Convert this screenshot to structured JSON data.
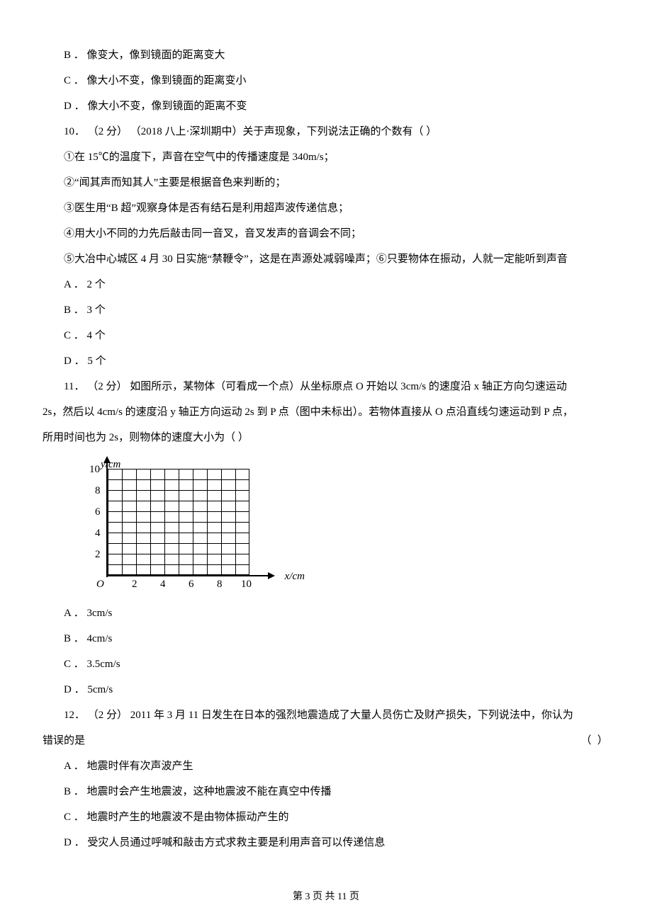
{
  "q9": {
    "opt_b": "B ． 像变大，像到镜面的距离变大",
    "opt_c": "C ． 像大小不变，像到镜面的距离变小",
    "opt_d": "D ． 像大小不变，像到镜面的距离不变"
  },
  "q10": {
    "stem": "10．  （2 分）  （2018 八上·深圳期中）关于声现象，下列说法正确的个数有（      ）",
    "s1": "①在 15℃的温度下，声音在空气中的传播速度是 340m/s；",
    "s2": "②“闻其声而知其人”主要是根据音色来判断的；",
    "s3": "③医生用“B 超”观察身体是否有结石是利用超声波传递信息；",
    "s4": "④用大小不同的力先后敲击同一音叉，音叉发声的音调会不同；",
    "s5": "⑤大冶中心城区 4 月 30 日实施“禁鞭令”，这是在声源处减弱噪声；⑥只要物体在振动，人就一定能听到声音",
    "opt_a": "A ． 2 个",
    "opt_b": "B ． 3 个",
    "opt_c": "C ． 4 个",
    "opt_d": "D ． 5 个"
  },
  "q11": {
    "stem_l1": "11．  （2 分）   如图所示，某物体（可看成一个点）从坐标原点 O 开始以 3cm/s 的速度沿 x 轴正方向匀速运动",
    "stem_l2": "2s，然后以 4cm/s 的速度沿 y 轴正方向运动 2s 到 P 点（图中未标出）。若物体直接从 O 点沿直线匀速运动到 P 点，",
    "stem_l3": "所用时间也为 2s，则物体的速度大小为（      ）",
    "opt_a": "A ． 3cm/s",
    "opt_b": "B ． 4cm/s",
    "opt_c": "C ． 3.5cm/s",
    "opt_d": "D ． 5cm/s"
  },
  "q12": {
    "stem_l1": "12．  （2 分）   2011 年 3 月 11 日发生在日本的强烈地震造成了大量人员伤亡及财产损失，下列说法中，你认为",
    "stem_l2_left": "错误的是",
    "stem_l2_right": "（      ）",
    "opt_a": "A ．  地震时伴有次声波产生",
    "opt_b": "B ．  地震时会产生地震波，这种地震波不能在真空中传播",
    "opt_c": "C ．  地震时产生的地震波不是由物体振动产生的",
    "opt_d": "D ．  受灾人员通过呼喊和敲击方式求救主要是利用声音可以传递信息"
  },
  "chart_data": {
    "type": "scatter",
    "title": "",
    "xlabel": "x/cm",
    "ylabel": "y/cm",
    "xlim": [
      0,
      10
    ],
    "ylim": [
      0,
      10
    ],
    "x_ticks": [
      2,
      4,
      6,
      8,
      10
    ],
    "y_ticks": [
      2,
      4,
      6,
      8,
      10
    ],
    "origin_label": "O",
    "grid": true,
    "series": []
  },
  "footer": "第 3 页 共 11 页"
}
